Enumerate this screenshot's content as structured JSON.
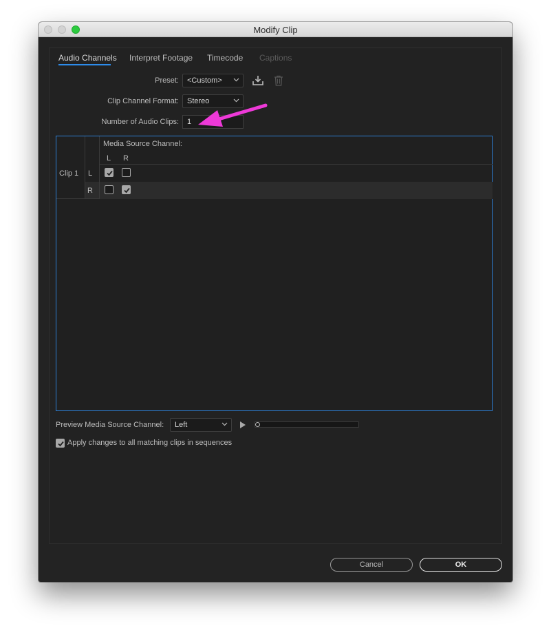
{
  "window": {
    "title": "Modify Clip"
  },
  "tabs": [
    {
      "label": "Audio Channels",
      "state": "active"
    },
    {
      "label": "Interpret Footage",
      "state": "normal"
    },
    {
      "label": "Timecode",
      "state": "normal"
    },
    {
      "label": "Captions",
      "state": "disabled"
    }
  ],
  "preset": {
    "label": "Preset:",
    "value": "<Custom>",
    "save_icon": "save-preset-icon",
    "delete_icon": "trash-icon"
  },
  "clip_channel_format": {
    "label": "Clip Channel Format:",
    "value": "Stereo"
  },
  "num_audio_clips": {
    "label": "Number of Audio Clips:",
    "value": "1"
  },
  "grid": {
    "header": "Media Source Channel:",
    "columns": [
      "L",
      "R"
    ],
    "clip_label": "Clip 1",
    "rows": [
      {
        "channel": "L",
        "checks": [
          true,
          false
        ]
      },
      {
        "channel": "R",
        "checks": [
          false,
          true
        ]
      }
    ]
  },
  "preview": {
    "label": "Preview Media Source Channel:",
    "value": "Left",
    "play_icon": "play-icon",
    "position": 0
  },
  "apply_all": {
    "label": "Apply changes to all matching clips in sequences",
    "checked": true
  },
  "buttons": {
    "cancel": "Cancel",
    "ok": "OK"
  },
  "colors": {
    "accent": "#2d8ceb",
    "annotation_arrow": "#ee39d8",
    "background": "#232323"
  }
}
